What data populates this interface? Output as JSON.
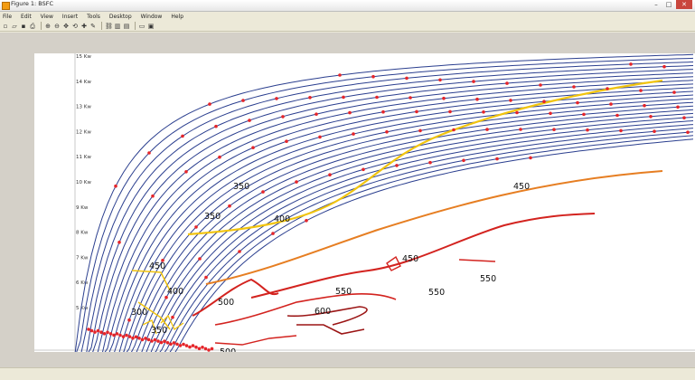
{
  "window": {
    "title": "Figure 1: BSFC",
    "controls": {
      "minimize": "–",
      "maximize": "□",
      "close": "✕"
    }
  },
  "menu": [
    "File",
    "Edit",
    "View",
    "Insert",
    "Tools",
    "Desktop",
    "Window",
    "Help"
  ],
  "toolbar": {
    "icons": [
      "new-icon",
      "open-icon",
      "save-icon",
      "print-icon",
      "zoom-in-icon",
      "zoom-out-icon",
      "pan-icon",
      "rotate-icon",
      "data-cursor-icon",
      "brush-icon",
      "link-icon",
      "colorbar-icon",
      "legend-icon",
      "hide-tools-icon",
      "show-tools-icon"
    ],
    "glyphs": [
      "▫",
      "▱",
      "▪",
      "⎙",
      "⊕",
      "⊖",
      "✥",
      "⟲",
      "✚",
      "✎",
      "⛓",
      "▥",
      "▤",
      "▭",
      "▣"
    ]
  },
  "colors": {
    "power_lines": "#2b3f8f",
    "points": "#e5252a",
    "bsfc_yellow": "#f1c40f",
    "bsfc_orange": "#e67e22",
    "bsfc_red": "#d3231f",
    "bsfc_darkred": "#9b1515"
  },
  "chart_data": {
    "type": "line",
    "y_tick_labels": [
      "5 Kw",
      "6 Kw",
      "7 Kw",
      "8 Kw",
      "9 Kw",
      "10 Kw",
      "11 Kw",
      "12 Kw",
      "13 Kw",
      "14 Kw",
      "15 Kw"
    ],
    "contour_labels": [
      "350",
      "350",
      "400",
      "450",
      "400",
      "300",
      "350",
      "500",
      "500",
      "550",
      "600",
      "450",
      "550",
      "550",
      "450"
    ],
    "grid": false
  }
}
